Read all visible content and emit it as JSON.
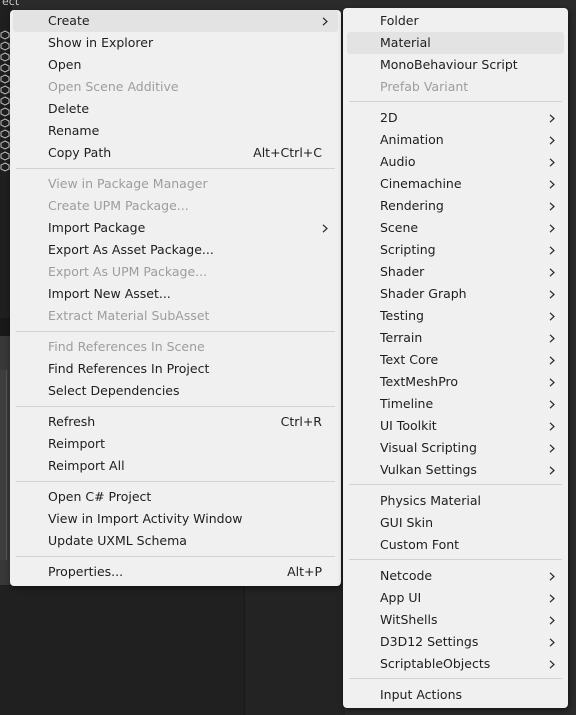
{
  "background": {
    "top_text": "ect"
  },
  "main_menu": {
    "items": [
      {
        "label": "Create",
        "submenu": true,
        "highlighted": true
      },
      {
        "label": "Show in Explorer"
      },
      {
        "label": "Open"
      },
      {
        "label": "Open Scene Additive",
        "disabled": true
      },
      {
        "label": "Delete"
      },
      {
        "label": "Rename"
      },
      {
        "label": "Copy Path",
        "shortcut": "Alt+Ctrl+C"
      },
      {
        "label": "View in Package Manager",
        "disabled": true
      },
      {
        "label": "Create UPM Package...",
        "disabled": true
      },
      {
        "label": "Import Package",
        "submenu": true
      },
      {
        "label": "Export As Asset Package..."
      },
      {
        "label": "Export As UPM Package...",
        "disabled": true
      },
      {
        "label": "Import New Asset..."
      },
      {
        "label": "Extract Material SubAsset",
        "disabled": true
      },
      {
        "label": "Find References In Scene",
        "disabled": true
      },
      {
        "label": "Find References In Project"
      },
      {
        "label": "Select Dependencies"
      },
      {
        "label": "Refresh",
        "shortcut": "Ctrl+R"
      },
      {
        "label": "Reimport"
      },
      {
        "label": "Reimport All"
      },
      {
        "label": "Open C# Project"
      },
      {
        "label": "View in Import Activity Window"
      },
      {
        "label": "Update UXML Schema"
      },
      {
        "label": "Properties...",
        "shortcut": "Alt+P"
      }
    ]
  },
  "create_submenu": {
    "items": [
      {
        "label": "Folder"
      },
      {
        "label": "Material",
        "highlighted": true
      },
      {
        "label": "MonoBehaviour Script"
      },
      {
        "label": "Prefab Variant",
        "disabled": true
      },
      {
        "label": "2D",
        "submenu": true
      },
      {
        "label": "Animation",
        "submenu": true
      },
      {
        "label": "Audio",
        "submenu": true
      },
      {
        "label": "Cinemachine",
        "submenu": true
      },
      {
        "label": "Rendering",
        "submenu": true
      },
      {
        "label": "Scene",
        "submenu": true
      },
      {
        "label": "Scripting",
        "submenu": true
      },
      {
        "label": "Shader",
        "submenu": true
      },
      {
        "label": "Shader Graph",
        "submenu": true
      },
      {
        "label": "Testing",
        "submenu": true
      },
      {
        "label": "Terrain",
        "submenu": true
      },
      {
        "label": "Text Core",
        "submenu": true
      },
      {
        "label": "TextMeshPro",
        "submenu": true
      },
      {
        "label": "Timeline",
        "submenu": true
      },
      {
        "label": "UI Toolkit",
        "submenu": true
      },
      {
        "label": "Visual Scripting",
        "submenu": true
      },
      {
        "label": "Vulkan Settings",
        "submenu": true
      },
      {
        "label": "Physics Material"
      },
      {
        "label": "GUI Skin"
      },
      {
        "label": "Custom Font"
      },
      {
        "label": "Netcode",
        "submenu": true
      },
      {
        "label": "App UI",
        "submenu": true
      },
      {
        "label": "WitShells",
        "submenu": true
      },
      {
        "label": "D3D12 Settings",
        "submenu": true
      },
      {
        "label": "ScriptableObjects",
        "submenu": true
      },
      {
        "label": "Input Actions"
      }
    ]
  },
  "colors": {
    "menu_bg": "#f0f0f0",
    "highlight": "#e3e3e3",
    "text": "#1e1e1e",
    "disabled_text": "#9d9d9d"
  }
}
